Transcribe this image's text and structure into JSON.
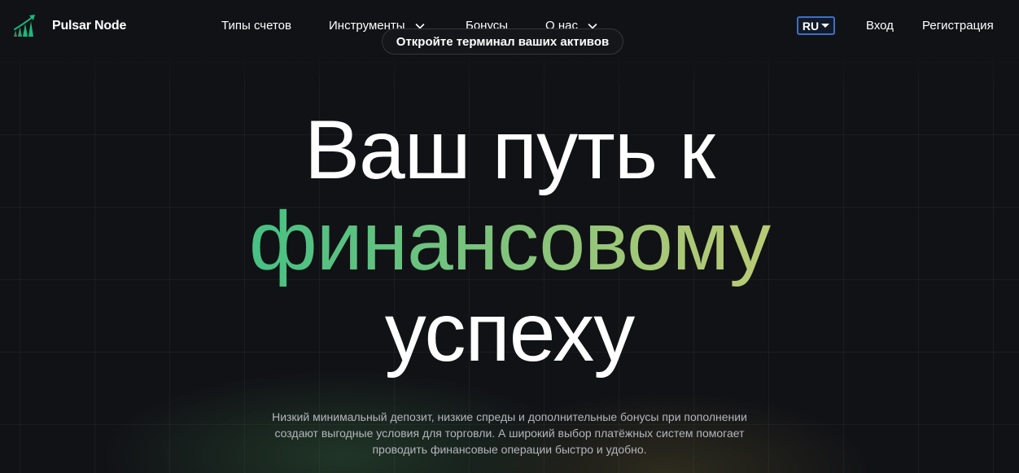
{
  "brand": {
    "name": "Pulsar Node",
    "logo_icon": "bar-chart-arrow-icon",
    "accent_green": "#1ab97d"
  },
  "nav": {
    "account_types": "Типы счетов",
    "instruments": "Инструменты",
    "bonuses": "Бонусы",
    "about": "О нас"
  },
  "header": {
    "language": "RU",
    "login": "Вход",
    "register": "Регистрация"
  },
  "hero": {
    "badge": "Откройте терминал ваших активов",
    "title_line1": "Ваш путь к",
    "title_line2": "финансовому",
    "title_line3": "успеху",
    "gradient_colors": [
      "#16c08a",
      "#e6cf6f"
    ],
    "subtitle": "Низкий минимальный депозит, низкие спреды и дополнительные бонусы при пополнении создают выгодные условия для торговли. А широкий выбор платёжных систем помогает проводить финансовые операции быстро и удобно."
  }
}
